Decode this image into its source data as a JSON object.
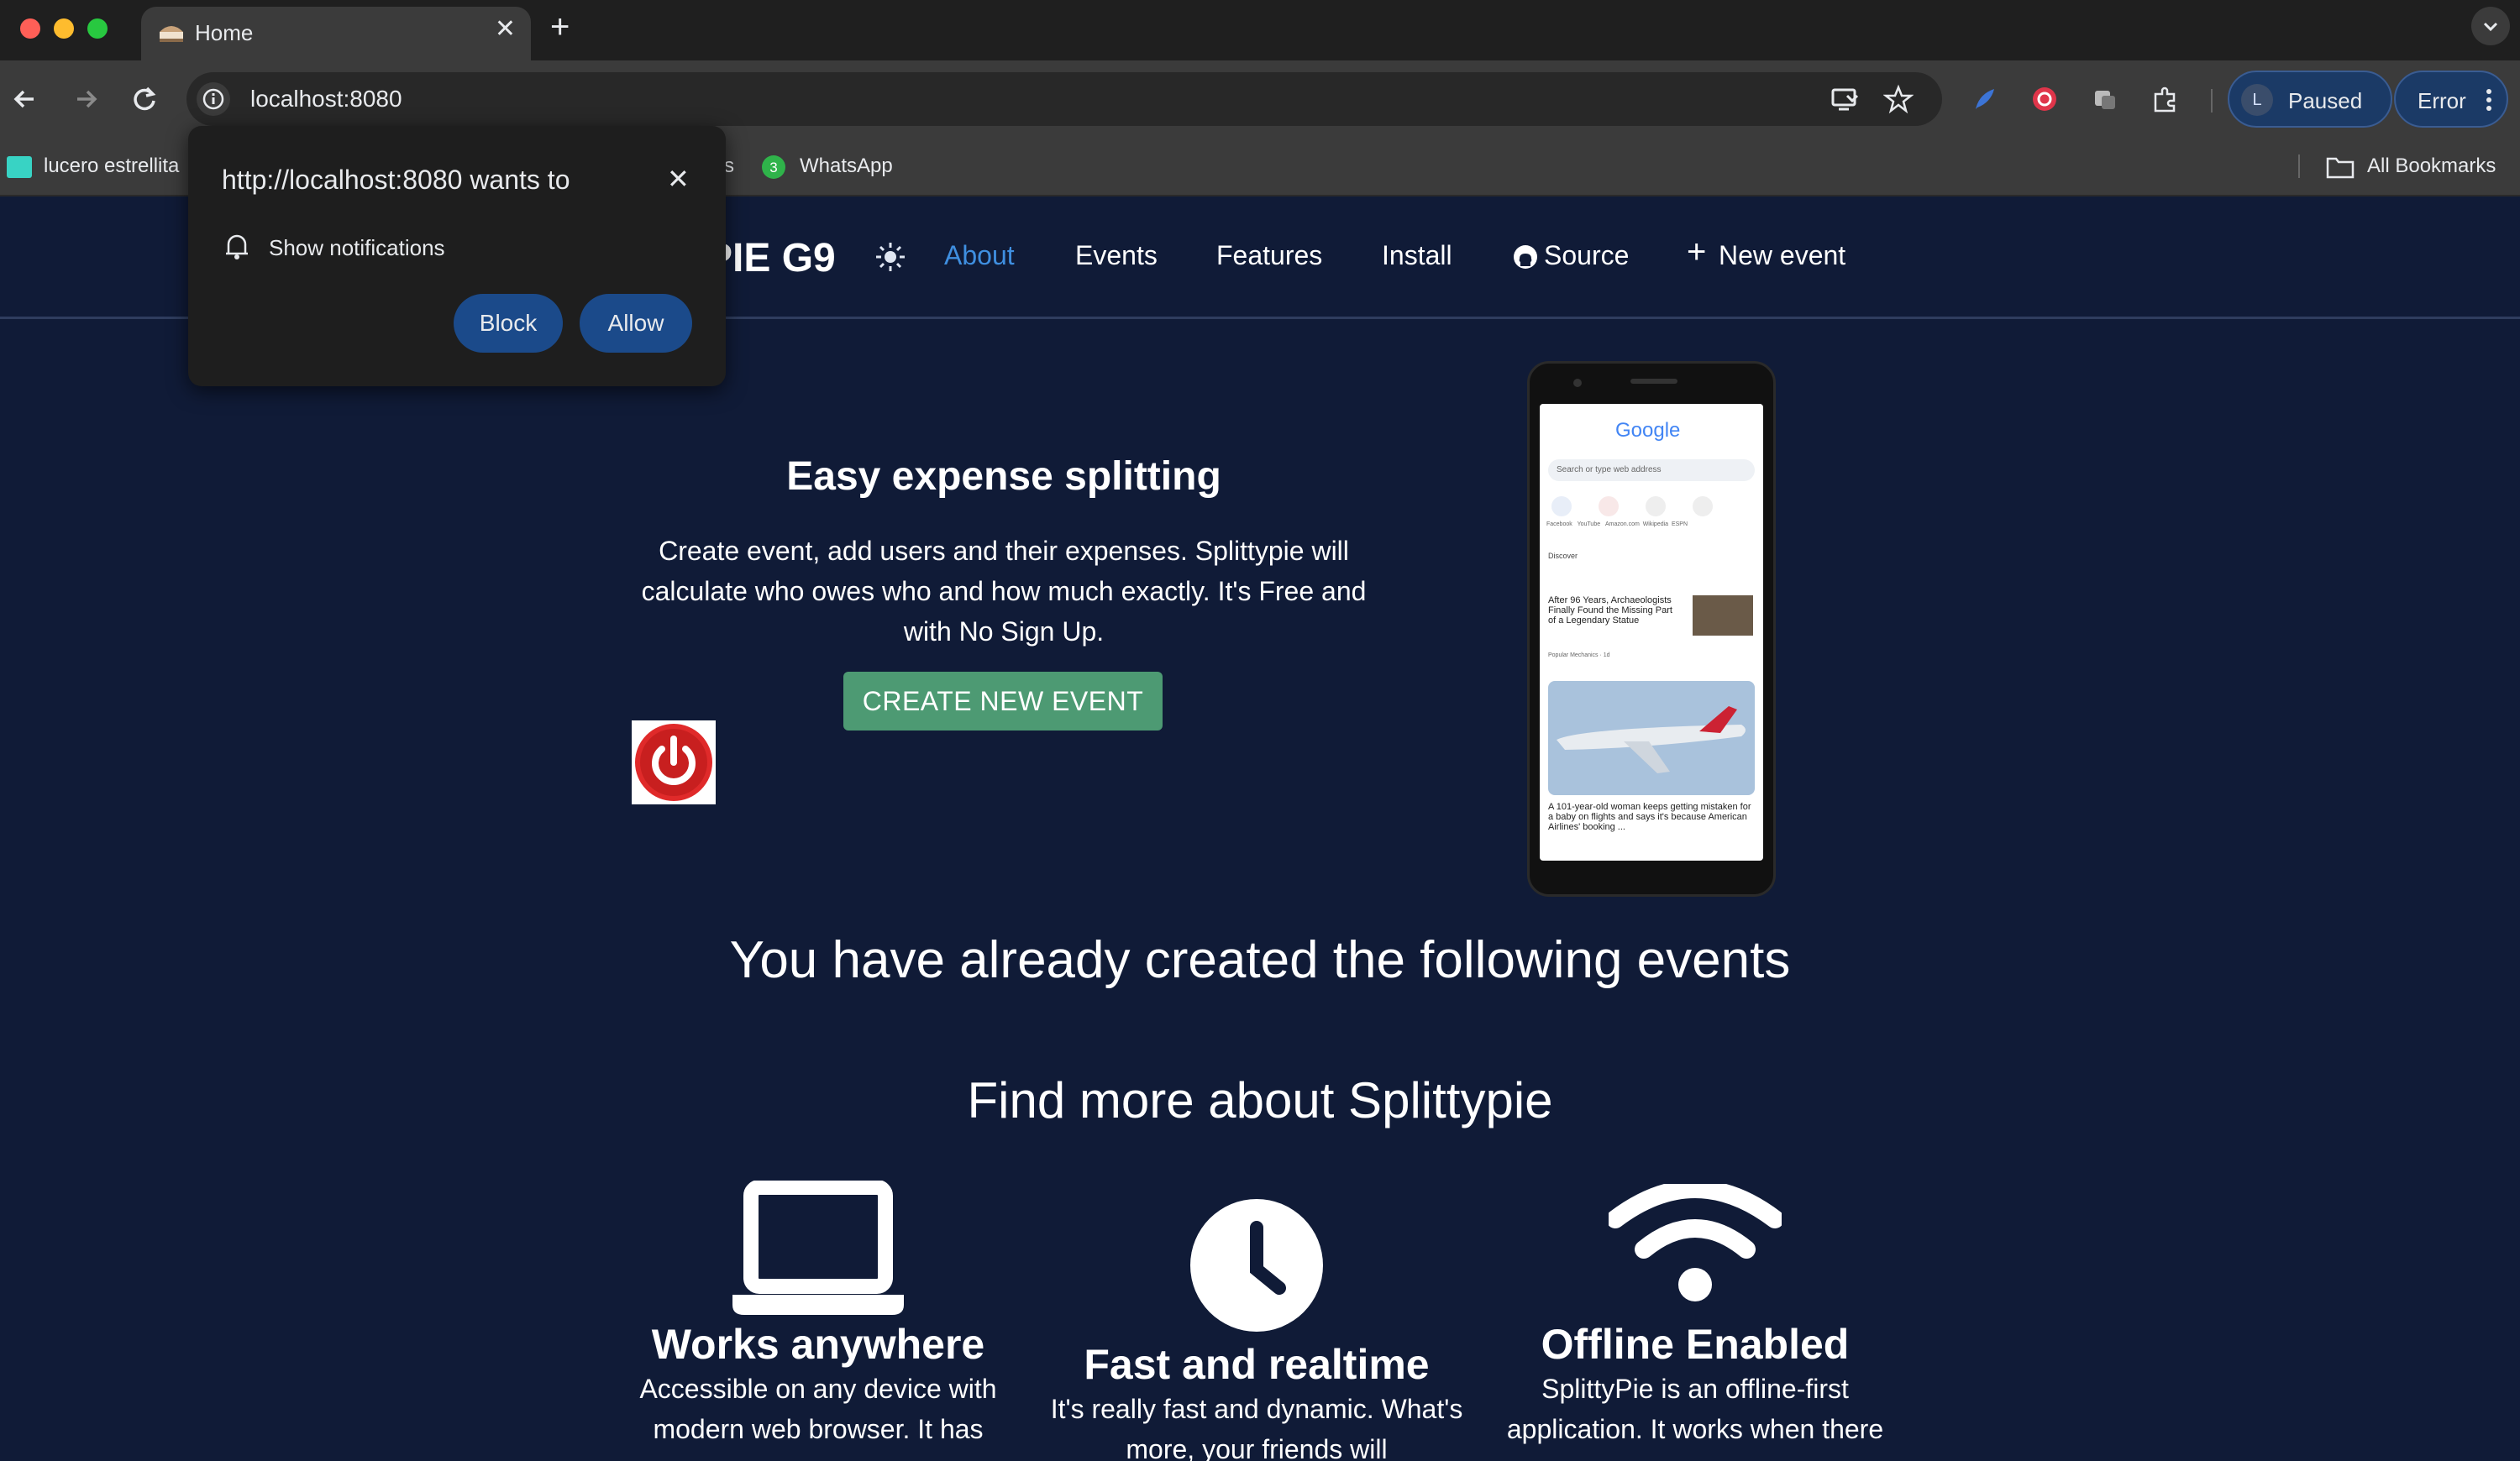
{
  "browser": {
    "tab_title": "Home",
    "url": "localhost:8080",
    "profile_initial": "L",
    "profile_status": "Paused",
    "error_label": "Error",
    "bookmarks": [
      "lucero estrellita",
      "s",
      "WhatsApp"
    ],
    "whatsapp_badge": "3",
    "all_bookmarks": "All Bookmarks"
  },
  "permission_popup": {
    "title": "http://localhost:8080 wants to",
    "permission": "Show notifications",
    "block_label": "Block",
    "allow_label": "Allow"
  },
  "site": {
    "brand": "PIE G9",
    "nav": {
      "about": "About",
      "events": "Events",
      "features": "Features",
      "install": "Install",
      "source": "Source",
      "new_event": "New event"
    },
    "hero": {
      "title": "Easy expense splitting",
      "description": "Create event, add users and their expenses. Splittypie will calculate who owes who and how much exactly. It's Free and with No Sign Up.",
      "cta": "CREATE NEW EVENT"
    },
    "phone_screen": {
      "search_placeholder": "Search or type web address",
      "shortcuts": [
        "Facebook",
        "YouTube",
        "Amazon.com",
        "Wikipedia",
        "ESPN"
      ],
      "discover": "Discover",
      "article1": "After 96 Years, Archaeologists Finally Found the Missing Part of a Legendary Statue",
      "article1_source": "Popular Mechanics · 1d",
      "article2": "A 101-year-old woman keeps getting mistaken for a baby on flights and says it's because American Airlines' booking ..."
    },
    "events_heading": "You have already created the following events",
    "more_heading": "Find more about Splittypie",
    "features": [
      {
        "title": "Works anywhere",
        "desc": "Accessible on any device with modern web browser. It has"
      },
      {
        "title": "Fast and realtime",
        "desc": "It's really fast and dynamic. What's more, your friends will"
      },
      {
        "title": "Offline Enabled",
        "desc": "SplittyPie is an offline-first application. It works when there"
      }
    ]
  },
  "colors": {
    "page_bg": "#101b37",
    "accent_link": "#3f8fe0",
    "cta_green": "#4d9a73",
    "popup_button": "#1b4a8a"
  }
}
